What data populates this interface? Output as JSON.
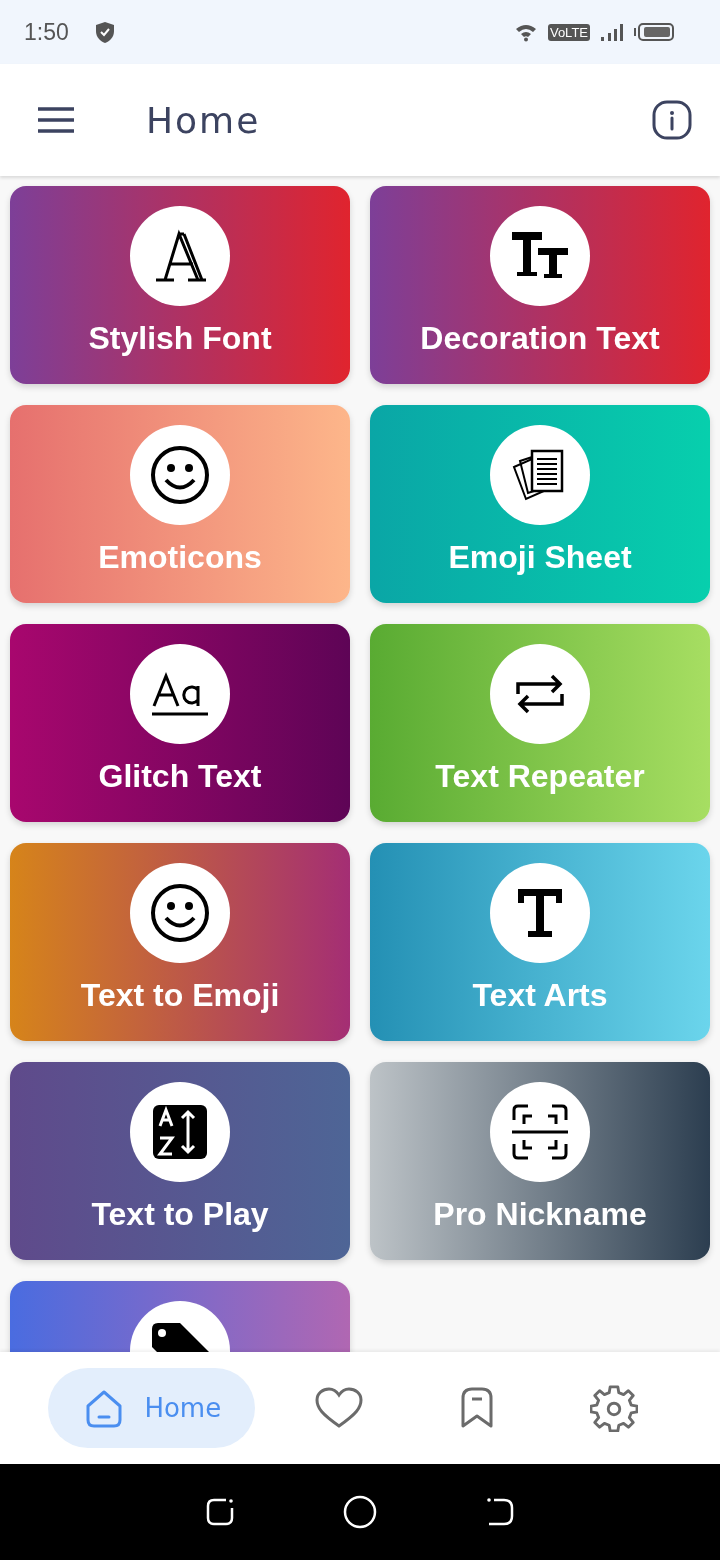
{
  "status_bar": {
    "time": "1:50",
    "network": "VoLTE"
  },
  "header": {
    "title": "Home"
  },
  "cards": [
    {
      "kind": "font",
      "label": "Stylish Font",
      "color": "#7d3f98",
      "end": {
        "color": "#e0242e"
      }
    },
    {
      "kind": "decoration",
      "label": "Decoration Text",
      "color": "#7d3f98",
      "end": {
        "color": "#e0242e"
      }
    },
    {
      "kind": "smiley",
      "label": "Emoticons",
      "color": "#e6706e",
      "end": {
        "color": "#fdb68a"
      }
    },
    {
      "kind": "sheet",
      "label": "Emoji Sheet",
      "color": "#0aa6a6",
      "end": {
        "color": "#07cfad"
      }
    },
    {
      "kind": "glyph",
      "label": "Glitch Text",
      "color": "#a8076e",
      "end": {
        "color": "#5e0456"
      }
    },
    {
      "kind": "repeat",
      "label": "Text Repeater",
      "color": "#59ab32",
      "end": {
        "color": "#a7de62"
      }
    },
    {
      "kind": "smiley",
      "label": "Text to Emoji",
      "color": "#d6841a",
      "end": {
        "color": "#a42e74"
      }
    },
    {
      "kind": "letter",
      "label": "Text Arts",
      "color": "#2490b4",
      "end": {
        "color": "#6bd5ec"
      }
    },
    {
      "kind": "sort",
      "label": "Text to Play",
      "color": "#5f4a8b",
      "end": {
        "color": "#4e6596"
      }
    },
    {
      "kind": "scan",
      "label": "Pro Nickname",
      "color": "#bdc3c7",
      "end": {
        "color": "#2c3e50"
      }
    },
    {
      "kind": "tag",
      "color": "#4a6ce0",
      "end": {
        "color": "#b067b2"
      }
    }
  ],
  "nav": [
    {
      "kind": "home",
      "label": "Home",
      "selected": true
    },
    {
      "kind": "heart",
      "selected": false
    },
    {
      "kind": "bookmark",
      "selected": false
    },
    {
      "kind": "settings",
      "selected": false
    }
  ]
}
